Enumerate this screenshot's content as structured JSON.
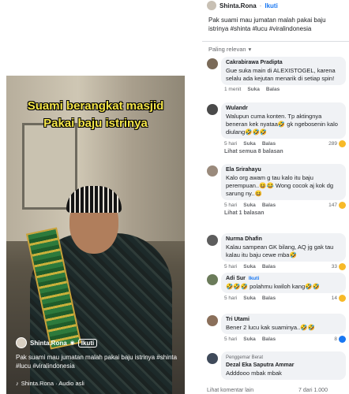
{
  "video": {
    "overlay_title_line1": "Suami berangkat masjid",
    "overlay_title_line2": "Pakai baju istrinya",
    "username": "Shinta.Rona",
    "follow": "Ikuti",
    "caption": "Pak suami mau jumatan malah pakai baju istrinya #shinta #lucu #viralindonesia",
    "audio": "Shinta.Rona · Audio asli"
  },
  "post": {
    "author": "Shinta.Rona",
    "follow": "Ikuti",
    "caption": "Pak suami mau jumatan malah pakai baju istrinya #shinta #lucu #viralindonesia",
    "sort_label": "Paling relevan"
  },
  "comments": [
    {
      "name": "Cakrabirawa Pradipta",
      "text": "Gue suka main di ALEXISTOGEL, karena selalu ada kejutan menarik di setiap spin!",
      "time": "1 menit",
      "like": "Suka",
      "reply": "Balas",
      "reacts": "",
      "more": ""
    },
    {
      "name": "Wulandr",
      "text": "Walupun cuma konten. Tp aktingnya beneran kek nyataa🤣 gk ngebosenin kalo diulang🤣🤣🤣",
      "time": "5 hari",
      "like": "Suka",
      "reply": "Balas",
      "reacts": "289",
      "more": "Lihat semua 8 balasan"
    },
    {
      "name": "Ela Srirahayu",
      "text": "Kalo org awam g tau kalo itu baju perempuan..😆😂 Wong cocok aj kok dg sarung ny..😆",
      "time": "5 hari",
      "like": "Suka",
      "reply": "Balas",
      "reacts": "147",
      "more": "Lihat 1 balasan"
    },
    {
      "name": "Nurma Dhafin",
      "text": "Kalau sampean GK bilang, AQ jg gak tau kalau itu baju cewe mba🤣",
      "time": "5 hari",
      "like": "Suka",
      "reply": "Balas",
      "reacts": "33",
      "more": ""
    },
    {
      "name": "Adi Sur",
      "tag": "Ikuti",
      "text": "🤣🤣🤣 polahmu kwiloh kang🤣🤣",
      "time": "5 hari",
      "like": "Suka",
      "reply": "Balas",
      "reacts": "14",
      "more": ""
    },
    {
      "name": "Tri Utami",
      "text": "Bener 2 lucu kak suaminya..🤣🤣",
      "time": "5 hari",
      "like": "Suka",
      "reply": "Balas",
      "reacts": "8",
      "more": ""
    },
    {
      "fan": "Penggemar Berat",
      "name": "Dezal Eka Saputra Ammar",
      "text": "Adddooo mbak mbak",
      "time": "",
      "like": "",
      "reply": "",
      "reacts": "",
      "more": ""
    }
  ],
  "bottom": {
    "left": "Lihat komentar lain",
    "right": "7 dari 1.000"
  },
  "colors": {
    "accent": "#1877f2",
    "overlay_text": "#f5e64a",
    "bubble": "#f0f2f5"
  }
}
